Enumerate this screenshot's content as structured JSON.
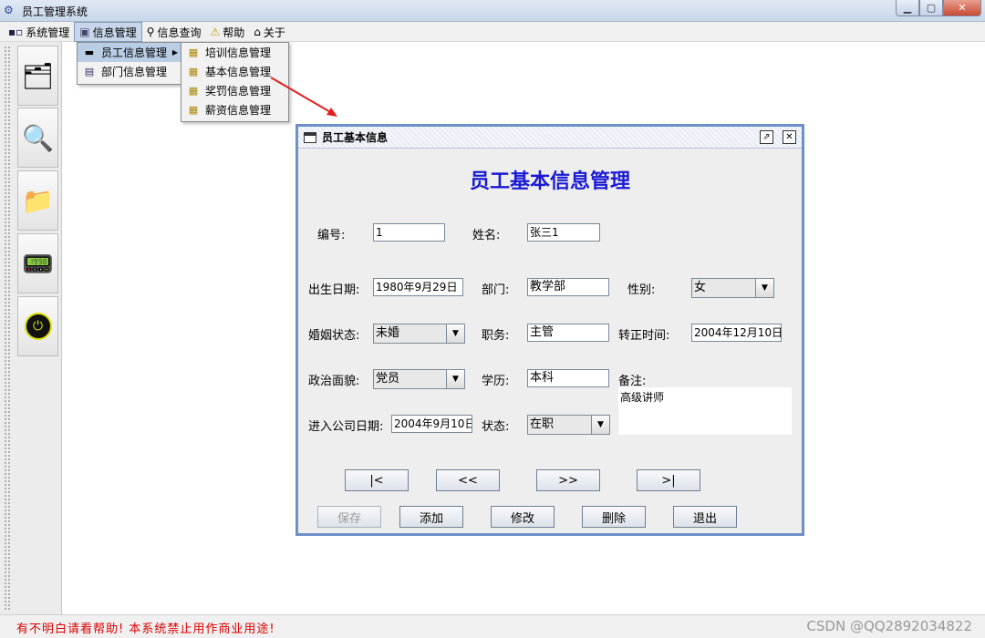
{
  "window": {
    "title": "员工管理系统",
    "controls": [
      "▁",
      "▢",
      "✕"
    ]
  },
  "menubar": {
    "items": [
      {
        "label": "系统管理",
        "icon": "system-icon"
      },
      {
        "label": "信息管理",
        "icon": "info-icon"
      },
      {
        "label": "信息查询",
        "icon": "search-icon"
      },
      {
        "label": "帮助",
        "icon": "warning-icon"
      },
      {
        "label": "关于",
        "icon": "home-icon"
      }
    ]
  },
  "dropdown1": {
    "items": [
      "员工信息管理",
      "部门信息管理"
    ]
  },
  "dropdown2": {
    "items": [
      "培训信息管理",
      "基本信息管理",
      "奖罚信息管理",
      "薪资信息管理"
    ]
  },
  "toolbar": {
    "icons": [
      "folder-edit-icon",
      "magnifier-icon",
      "folder-key-icon",
      "pda-icon",
      "power-icon"
    ]
  },
  "frame": {
    "title": "员工基本信息",
    "heading": "员工基本信息管理",
    "labels": {
      "id": "编号:",
      "name": "姓名:",
      "birth": "出生日期:",
      "dept": "部门:",
      "gender": "性别:",
      "marital": "婚姻状态:",
      "position": "职务:",
      "regular": "转正时间:",
      "political": "政治面貌:",
      "education": "学历:",
      "remark": "备注:",
      "join": "进入公司日期:",
      "status": "状态:"
    },
    "values": {
      "id": "1",
      "name": "张三1",
      "birth": "1980年9月29日",
      "dept": "教学部",
      "gender": "女",
      "marital": "未婚",
      "position": "主管",
      "regular": "2004年12月10日",
      "political": "党员",
      "education": "本科",
      "remark": "高级讲师",
      "join": "2004年9月10日",
      "status": "在职"
    },
    "nav": [
      "|<",
      "<<",
      ">>",
      ">|"
    ],
    "actions": {
      "save": "保存",
      "add": "添加",
      "edit": "修改",
      "delete": "删除",
      "exit": "退出"
    }
  },
  "status": {
    "left": "有不明白请看帮助!   本系统禁止用作商业用途!",
    "watermark": "CSDN @QQ2892034822"
  }
}
